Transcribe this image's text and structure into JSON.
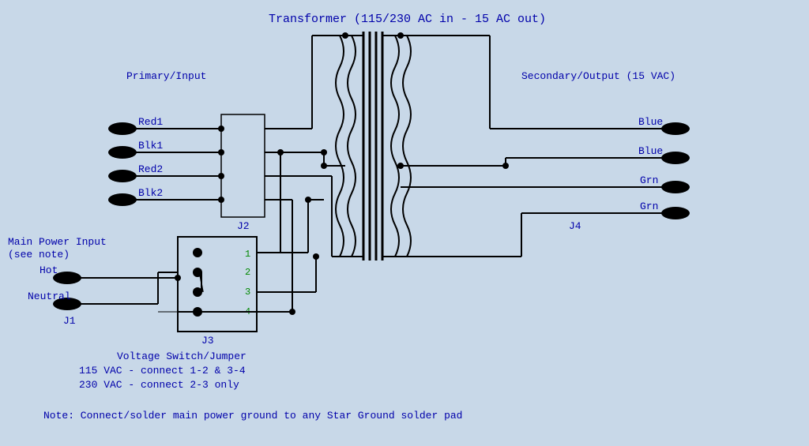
{
  "title": "Transformer (115/230 AC in - 15 AC out)",
  "primary_label": "Primary/Input",
  "secondary_label": "Secondary/Output (15 VAC)",
  "main_power_label": "Main Power Input\n(see note)",
  "j1_label": "J1",
  "j2_label": "J2",
  "j3_label": "J3",
  "j4_label": "J4",
  "primary_wires": [
    "Red1",
    "Blk1",
    "Red2",
    "Blk2"
  ],
  "secondary_wires": [
    "Blue",
    "Blue",
    "Grn",
    "Grn"
  ],
  "power_wires": [
    "Hot",
    "Neutral"
  ],
  "switch_label": "Voltage Switch/Jumper",
  "switch_line1": "115 VAC - connect 1-2 & 3-4",
  "switch_line2": "230 VAC - connect 2-3 only",
  "note_label": "Note:   Connect/solder main power ground to any Star Ground solder pad",
  "switch_pins": [
    "1",
    "2",
    "3",
    "4"
  ],
  "colors": {
    "blue": "#0000aa",
    "green": "#006600",
    "bg": "#c8d8e8",
    "line": "#000000",
    "pin_green": "#008800"
  }
}
